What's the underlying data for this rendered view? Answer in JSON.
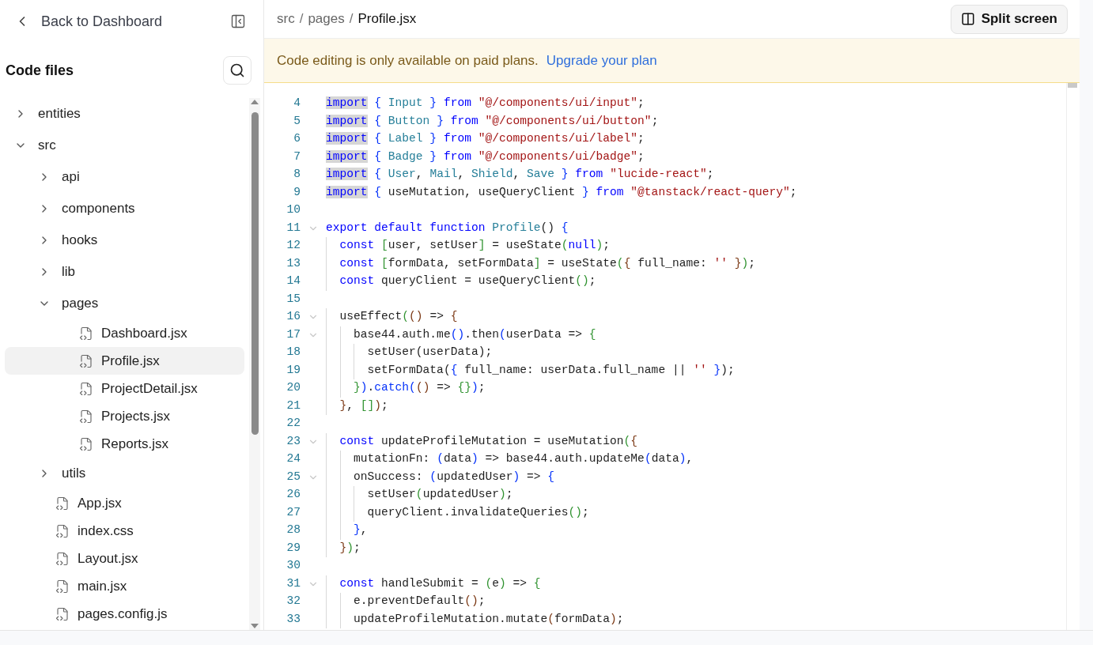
{
  "sidebar": {
    "back_label": "Back to Dashboard",
    "title": "Code files",
    "tree": [
      {
        "name": "entities",
        "kind": "folder",
        "expanded": false,
        "selected": false
      },
      {
        "name": "src",
        "kind": "folder",
        "expanded": true,
        "selected": false,
        "children": [
          {
            "name": "api",
            "kind": "folder",
            "expanded": false,
            "selected": false
          },
          {
            "name": "components",
            "kind": "folder",
            "expanded": false,
            "selected": false
          },
          {
            "name": "hooks",
            "kind": "folder",
            "expanded": false,
            "selected": false
          },
          {
            "name": "lib",
            "kind": "folder",
            "expanded": false,
            "selected": false
          },
          {
            "name": "pages",
            "kind": "folder",
            "expanded": true,
            "selected": false,
            "children": [
              {
                "name": "Dashboard.jsx",
                "kind": "file",
                "selected": false
              },
              {
                "name": "Profile.jsx",
                "kind": "file",
                "selected": true
              },
              {
                "name": "ProjectDetail.jsx",
                "kind": "file",
                "selected": false
              },
              {
                "name": "Projects.jsx",
                "kind": "file",
                "selected": false
              },
              {
                "name": "Reports.jsx",
                "kind": "file",
                "selected": false
              }
            ]
          },
          {
            "name": "utils",
            "kind": "folder",
            "expanded": false,
            "selected": false
          },
          {
            "name": "App.jsx",
            "kind": "file",
            "selected": false
          },
          {
            "name": "index.css",
            "kind": "file",
            "selected": false
          },
          {
            "name": "Layout.jsx",
            "kind": "file",
            "selected": false
          },
          {
            "name": "main.jsx",
            "kind": "file",
            "selected": false
          },
          {
            "name": "pages.config.js",
            "kind": "file",
            "selected": false
          }
        ]
      }
    ]
  },
  "breadcrumb": [
    "src",
    "pages",
    "Profile.jsx"
  ],
  "breadcrumb_separator": "/",
  "split_button": "Split screen",
  "banner": {
    "message": "Code editing is only available on paid plans.",
    "link": "Upgrade your plan"
  },
  "code_lines": [
    {
      "number": "4",
      "fold": false,
      "tokens": [
        {
          "kind": "kwm",
          "text": "import"
        },
        {
          "kind": "b1",
          "text": " {"
        },
        {
          "kind": "id",
          "text": " Input"
        },
        {
          "kind": "b1",
          "text": " }"
        },
        {
          "kind": "kw",
          "text": " from"
        },
        {
          "kind": "str",
          "text": " \"@/components/ui/input\""
        },
        {
          "kind": "p",
          "text": ";"
        }
      ]
    },
    {
      "number": "5",
      "fold": false,
      "tokens": [
        {
          "kind": "kwm",
          "text": "import"
        },
        {
          "kind": "b1",
          "text": " {"
        },
        {
          "kind": "id",
          "text": " Button"
        },
        {
          "kind": "b1",
          "text": " }"
        },
        {
          "kind": "kw",
          "text": " from"
        },
        {
          "kind": "str",
          "text": " \"@/components/ui/button\""
        },
        {
          "kind": "p",
          "text": ";"
        }
      ]
    },
    {
      "number": "6",
      "fold": false,
      "tokens": [
        {
          "kind": "kwm",
          "text": "import"
        },
        {
          "kind": "b1",
          "text": " {"
        },
        {
          "kind": "id",
          "text": " Label"
        },
        {
          "kind": "b1",
          "text": " }"
        },
        {
          "kind": "kw",
          "text": " from"
        },
        {
          "kind": "str",
          "text": " \"@/components/ui/label\""
        },
        {
          "kind": "p",
          "text": ";"
        }
      ]
    },
    {
      "number": "7",
      "fold": false,
      "tokens": [
        {
          "kind": "kwm",
          "text": "import"
        },
        {
          "kind": "b1",
          "text": " {"
        },
        {
          "kind": "id",
          "text": " Badge"
        },
        {
          "kind": "b1",
          "text": " }"
        },
        {
          "kind": "kw",
          "text": " from"
        },
        {
          "kind": "str",
          "text": " \"@/components/ui/badge\""
        },
        {
          "kind": "p",
          "text": ";"
        }
      ]
    },
    {
      "number": "8",
      "fold": false,
      "tokens": [
        {
          "kind": "kwm",
          "text": "import"
        },
        {
          "kind": "b1",
          "text": " {"
        },
        {
          "kind": "id",
          "text": " User"
        },
        {
          "kind": "p",
          "text": ","
        },
        {
          "kind": "id",
          "text": " Mail"
        },
        {
          "kind": "p",
          "text": ","
        },
        {
          "kind": "id",
          "text": " Shield"
        },
        {
          "kind": "p",
          "text": ","
        },
        {
          "kind": "id",
          "text": " Save"
        },
        {
          "kind": "b1",
          "text": " }"
        },
        {
          "kind": "kw",
          "text": " from"
        },
        {
          "kind": "str",
          "text": " \"lucide-react\""
        },
        {
          "kind": "p",
          "text": ";"
        }
      ]
    },
    {
      "number": "9",
      "fold": false,
      "tokens": [
        {
          "kind": "kwm",
          "text": "import"
        },
        {
          "kind": "b1",
          "text": " {"
        },
        {
          "kind": "p",
          "text": " useMutation, useQueryClient"
        },
        {
          "kind": "b1",
          "text": " }"
        },
        {
          "kind": "kw",
          "text": " from"
        },
        {
          "kind": "str",
          "text": " \"@tanstack/react-query\""
        },
        {
          "kind": "p",
          "text": ";"
        }
      ]
    },
    {
      "number": "10",
      "fold": false
    },
    {
      "number": "11",
      "fold": true,
      "tokens": [
        {
          "kind": "kw",
          "text": "export default function"
        },
        {
          "kind": "id",
          "text": " Profile"
        },
        {
          "kind": "p",
          "text": "()"
        },
        {
          "kind": "b1",
          "text": " {"
        }
      ]
    },
    {
      "number": "12",
      "fold": false,
      "tokens": [
        {
          "kind": "kw",
          "text": "  const"
        },
        {
          "kind": "b2",
          "text": " ["
        },
        {
          "kind": "p",
          "text": "user, setUser"
        },
        {
          "kind": "b2",
          "text": "]"
        },
        {
          "kind": "p",
          "text": " = useState"
        },
        {
          "kind": "b2",
          "text": "("
        },
        {
          "kind": "kw",
          "text": "null"
        },
        {
          "kind": "b2",
          "text": ")"
        },
        {
          "kind": "p",
          "text": ";"
        }
      ]
    },
    {
      "number": "13",
      "fold": false,
      "tokens": [
        {
          "kind": "kw",
          "text": "  const"
        },
        {
          "kind": "b2",
          "text": " ["
        },
        {
          "kind": "p",
          "text": "formData, setFormData"
        },
        {
          "kind": "b2",
          "text": "]"
        },
        {
          "kind": "p",
          "text": " = useState"
        },
        {
          "kind": "b2",
          "text": "("
        },
        {
          "kind": "b3",
          "text": "{"
        },
        {
          "kind": "p",
          "text": " full_name:"
        },
        {
          "kind": "str",
          "text": " ''"
        },
        {
          "kind": "b3",
          "text": " }"
        },
        {
          "kind": "b2",
          "text": ")"
        },
        {
          "kind": "p",
          "text": ";"
        }
      ]
    },
    {
      "number": "14",
      "fold": false,
      "tokens": [
        {
          "kind": "kw",
          "text": "  const"
        },
        {
          "kind": "p",
          "text": " queryClient = useQueryClient"
        },
        {
          "kind": "b2",
          "text": "()"
        },
        {
          "kind": "p",
          "text": ";"
        }
      ]
    },
    {
      "number": "15",
      "fold": false
    },
    {
      "number": "16",
      "fold": true,
      "tokens": [
        {
          "kind": "p",
          "text": "  useEffect"
        },
        {
          "kind": "b2",
          "text": "("
        },
        {
          "kind": "b3",
          "text": "()"
        },
        {
          "kind": "p",
          "text": " =>"
        },
        {
          "kind": "b3",
          "text": " {"
        }
      ]
    },
    {
      "number": "17",
      "fold": true,
      "tokens": [
        {
          "kind": "p",
          "text": "    base44.auth.me"
        },
        {
          "kind": "b1",
          "text": "()"
        },
        {
          "kind": "p",
          "text": ".then"
        },
        {
          "kind": "b1",
          "text": "("
        },
        {
          "kind": "p",
          "text": "userData =>"
        },
        {
          "kind": "b2",
          "text": " {"
        }
      ]
    },
    {
      "number": "18",
      "fold": false,
      "tokens": [
        {
          "kind": "p",
          "text": "      setUser(userData);"
        }
      ]
    },
    {
      "number": "19",
      "fold": false,
      "tokens": [
        {
          "kind": "p",
          "text": "      setFormData("
        },
        {
          "kind": "b1",
          "text": "{"
        },
        {
          "kind": "p",
          "text": " full_name: userData.full_name ||"
        },
        {
          "kind": "str",
          "text": " ''"
        },
        {
          "kind": "b1",
          "text": " }"
        },
        {
          "kind": "p",
          "text": ");"
        }
      ]
    },
    {
      "number": "20",
      "fold": false,
      "tokens": [
        {
          "kind": "b2",
          "text": "    }"
        },
        {
          "kind": "b1",
          "text": ")"
        },
        {
          "kind": "p",
          "text": "."
        },
        {
          "kind": "b1",
          "text": "catch("
        },
        {
          "kind": "b3",
          "text": "()"
        },
        {
          "kind": "p",
          "text": " =>"
        },
        {
          "kind": "b2",
          "text": " {}"
        },
        {
          "kind": "b1",
          "text": ")"
        },
        {
          "kind": "p",
          "text": ";"
        }
      ]
    },
    {
      "number": "21",
      "fold": false,
      "tokens": [
        {
          "kind": "b3",
          "text": "  }"
        },
        {
          "kind": "p",
          "text": ","
        },
        {
          "kind": "b2",
          "text": " []"
        },
        {
          "kind": "b3",
          "text": ")"
        },
        {
          "kind": "p",
          "text": ";"
        }
      ]
    },
    {
      "number": "22",
      "fold": false
    },
    {
      "number": "23",
      "fold": true,
      "tokens": [
        {
          "kind": "kw",
          "text": "  const"
        },
        {
          "kind": "p",
          "text": " updateProfileMutation = useMutation"
        },
        {
          "kind": "b2",
          "text": "("
        },
        {
          "kind": "b3",
          "text": "{"
        }
      ]
    },
    {
      "number": "24",
      "fold": false,
      "tokens": [
        {
          "kind": "p",
          "text": "    mutationFn:"
        },
        {
          "kind": "b1",
          "text": " ("
        },
        {
          "kind": "p",
          "text": "data"
        },
        {
          "kind": "b1",
          "text": ")"
        },
        {
          "kind": "p",
          "text": " => base44.auth.updateMe"
        },
        {
          "kind": "b1",
          "text": "("
        },
        {
          "kind": "p",
          "text": "data"
        },
        {
          "kind": "b1",
          "text": ")"
        },
        {
          "kind": "p",
          "text": ","
        }
      ]
    },
    {
      "number": "25",
      "fold": true,
      "tokens": [
        {
          "kind": "p",
          "text": "    onSuccess:"
        },
        {
          "kind": "b1",
          "text": " ("
        },
        {
          "kind": "p",
          "text": "updatedUser"
        },
        {
          "kind": "b1",
          "text": ")"
        },
        {
          "kind": "p",
          "text": " =>"
        },
        {
          "kind": "b1",
          "text": " {"
        }
      ]
    },
    {
      "number": "26",
      "fold": false,
      "tokens": [
        {
          "kind": "p",
          "text": "      setUser"
        },
        {
          "kind": "b2",
          "text": "("
        },
        {
          "kind": "p",
          "text": "updatedUser"
        },
        {
          "kind": "b2",
          "text": ")"
        },
        {
          "kind": "p",
          "text": ";"
        }
      ]
    },
    {
      "number": "27",
      "fold": false,
      "tokens": [
        {
          "kind": "p",
          "text": "      queryClient.invalidateQueries"
        },
        {
          "kind": "b2",
          "text": "()"
        },
        {
          "kind": "p",
          "text": ";"
        }
      ]
    },
    {
      "number": "28",
      "fold": false,
      "tokens": [
        {
          "kind": "b1",
          "text": "    }"
        },
        {
          "kind": "p",
          "text": ","
        }
      ]
    },
    {
      "number": "29",
      "fold": false,
      "tokens": [
        {
          "kind": "b3",
          "text": "  }"
        },
        {
          "kind": "b2",
          "text": ")"
        },
        {
          "kind": "p",
          "text": ";"
        }
      ]
    },
    {
      "number": "30",
      "fold": false
    },
    {
      "number": "31",
      "fold": true,
      "tokens": [
        {
          "kind": "kw",
          "text": "  const"
        },
        {
          "kind": "p",
          "text": " handleSubmit ="
        },
        {
          "kind": "b2",
          "text": " ("
        },
        {
          "kind": "p",
          "text": "e"
        },
        {
          "kind": "b2",
          "text": ")"
        },
        {
          "kind": "p",
          "text": " =>"
        },
        {
          "kind": "b2",
          "text": " {"
        }
      ]
    },
    {
      "number": "32",
      "fold": false,
      "tokens": [
        {
          "kind": "p",
          "text": "    e.preventDefault"
        },
        {
          "kind": "b3",
          "text": "()"
        },
        {
          "kind": "p",
          "text": ";"
        }
      ]
    },
    {
      "number": "33",
      "fold": false,
      "tokens": [
        {
          "kind": "p",
          "text": "    updateProfileMutation.mutate"
        },
        {
          "kind": "b3",
          "text": "("
        },
        {
          "kind": "p",
          "text": "formData"
        },
        {
          "kind": "b3",
          "text": ")"
        },
        {
          "kind": "p",
          "text": ";"
        }
      ]
    }
  ]
}
